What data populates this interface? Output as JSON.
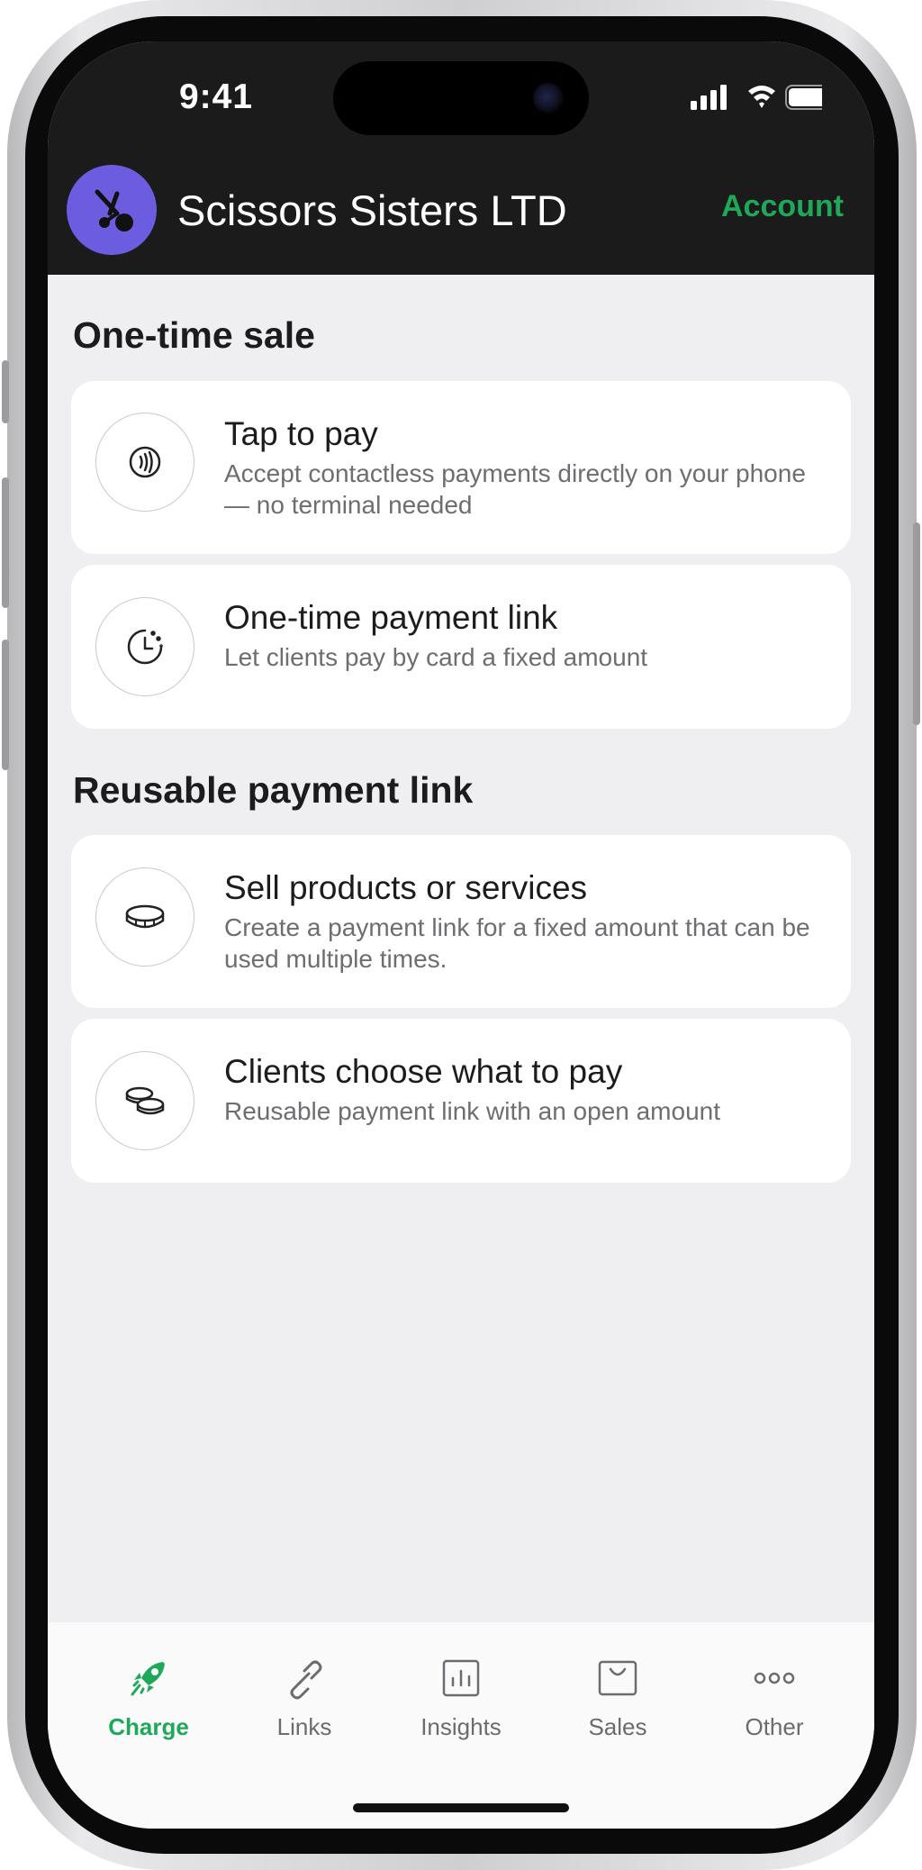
{
  "status_bar": {
    "time": "9:41"
  },
  "header": {
    "business_name": "Scissors Sisters LTD",
    "account_label": "Account",
    "avatar_icon": "scissors-icon"
  },
  "sections": [
    {
      "title": "One-time sale",
      "cards": [
        {
          "title": "Tap to pay",
          "description": "Accept contactless payments directly on your phone — no terminal needed",
          "icon": "contactless-icon"
        },
        {
          "title": "One-time payment link",
          "description": "Let clients pay by card a fixed amount",
          "icon": "timer-icon"
        }
      ]
    },
    {
      "title": "Reusable payment link",
      "cards": [
        {
          "title": "Sell products or services",
          "description": "Create a payment link for a fixed amount that can be used multiple times.",
          "icon": "coin-icon"
        },
        {
          "title": "Clients choose what to pay",
          "description": "Reusable payment link with an open amount",
          "icon": "coins-stack-icon"
        }
      ]
    }
  ],
  "tabs": [
    {
      "label": "Charge",
      "icon": "rocket-icon",
      "active": true
    },
    {
      "label": "Links",
      "icon": "link-icon",
      "active": false
    },
    {
      "label": "Insights",
      "icon": "bar-chart-icon",
      "active": false
    },
    {
      "label": "Sales",
      "icon": "shopping-bag-icon",
      "active": false
    },
    {
      "label": "Other",
      "icon": "more-dots-icon",
      "active": false
    }
  ],
  "colors": {
    "accent": "#1fa85a",
    "avatar": "#6c5ce0",
    "header_bg": "#1b1b1b",
    "screen_bg": "#efeff1"
  }
}
